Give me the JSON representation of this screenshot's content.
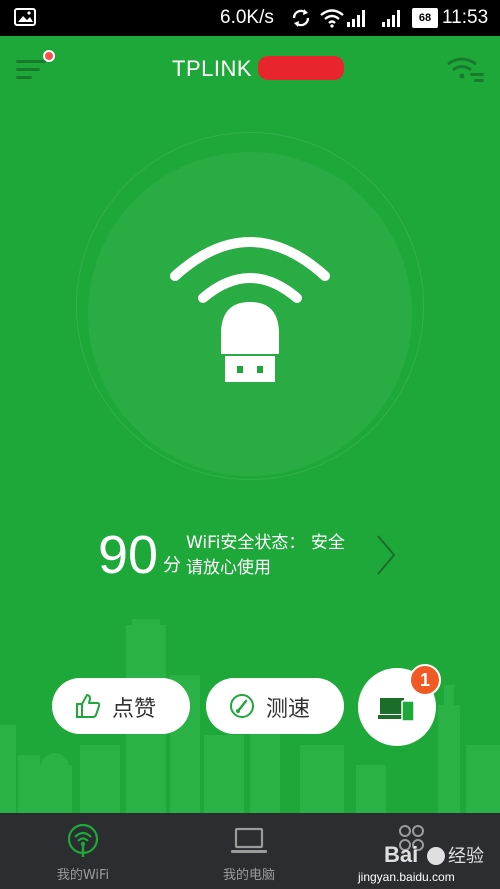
{
  "status_bar": {
    "net_speed": "6.0K/s",
    "battery": "68",
    "time": "11:53",
    "icons": [
      "gallery-icon",
      "sync-icon",
      "wifi-icon",
      "signal-icon",
      "signal-icon",
      "battery-icon"
    ]
  },
  "header": {
    "title": "TPLINK",
    "menu_icon": "menu-icon",
    "settings_icon": "wifi-settings-icon"
  },
  "hero": {
    "icon": "router-wifi-icon"
  },
  "security": {
    "score": "90",
    "unit": "分",
    "line1": "WiFi安全状态： 安全",
    "line2": "请放心使用"
  },
  "actions": {
    "like_label": "点赞",
    "speed_label": "测速",
    "devices_badge": "1"
  },
  "bottom_nav": {
    "items": [
      {
        "label": "我的WiFi",
        "icon": "wifi-broadcast-icon"
      },
      {
        "label": "我的电脑",
        "icon": "laptop-icon"
      },
      {
        "label": "",
        "icon": "apps-icon"
      }
    ]
  },
  "watermark": {
    "text": "jingyan.baidu.com",
    "brand": "经验"
  },
  "colors": {
    "primary_green": "#1ea83a",
    "badge_orange": "#f15a24",
    "nav_bg": "#2b2d30"
  }
}
